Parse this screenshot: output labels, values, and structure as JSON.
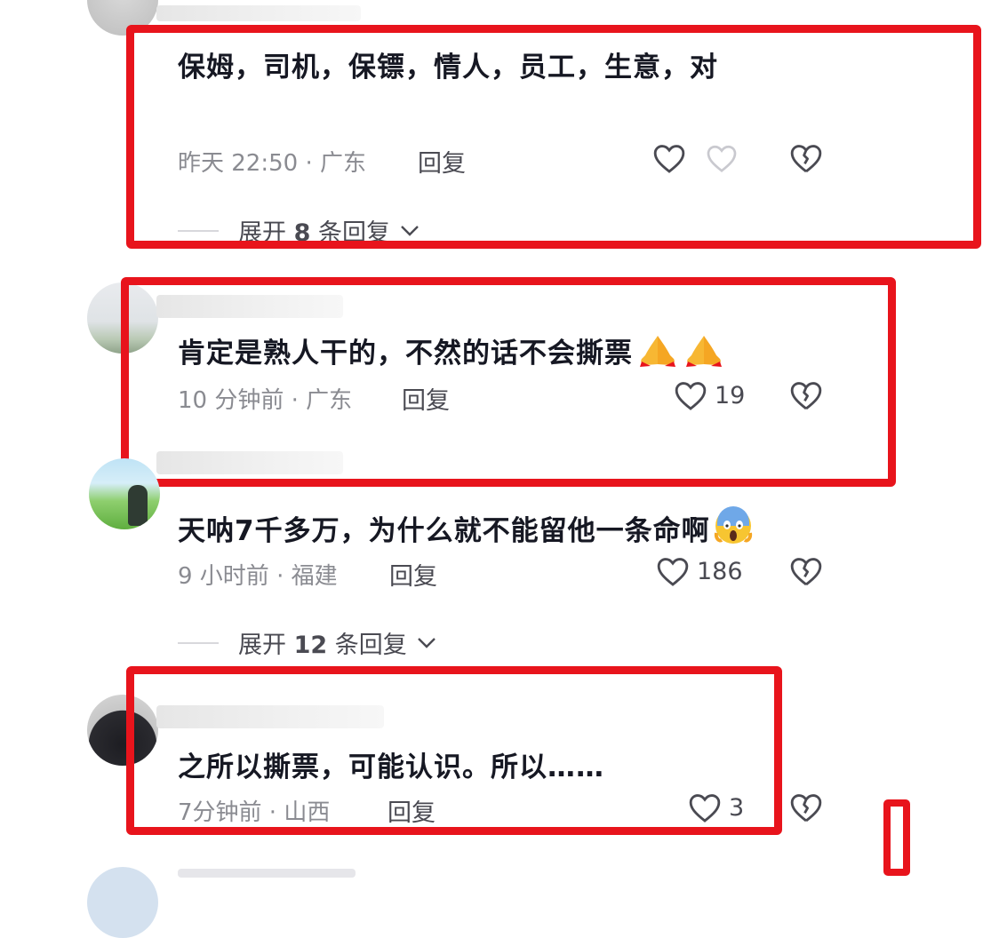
{
  "comments": [
    {
      "text": "保姆，司机，保镖，情人，员工，生意，对",
      "meta": "昨天 22:50 · 广东",
      "reply_label": "回复",
      "likes": "",
      "expand": {
        "prefix": "展开 ",
        "count": "8",
        "suffix": " 条回复"
      }
    },
    {
      "text": "肯定是熟人干的，不然的话不会撕票",
      "emoji": [
        "folded-hands-emoji",
        "folded-hands-emoji"
      ],
      "meta": "10 分钟前 · 广东",
      "reply_label": "回复",
      "likes": "19"
    },
    {
      "text": "天呐7千多万，为什么就不能留他一条命啊",
      "emoji": [
        "screaming-face-emoji"
      ],
      "meta": "9 小时前 · 福建",
      "reply_label": "回复",
      "likes": "186",
      "expand": {
        "prefix": "展开 ",
        "count": "12",
        "suffix": " 条回复"
      }
    },
    {
      "text": "之所以撕票，可能认识。所以……",
      "meta": "7分钟前 · 山西",
      "reply_label": "回复",
      "likes": "3"
    }
  ],
  "colors": {
    "highlight": "#e8141c",
    "text_primary": "#161823",
    "text_secondary": "#8a8b91",
    "icon": "#4a4a52"
  }
}
